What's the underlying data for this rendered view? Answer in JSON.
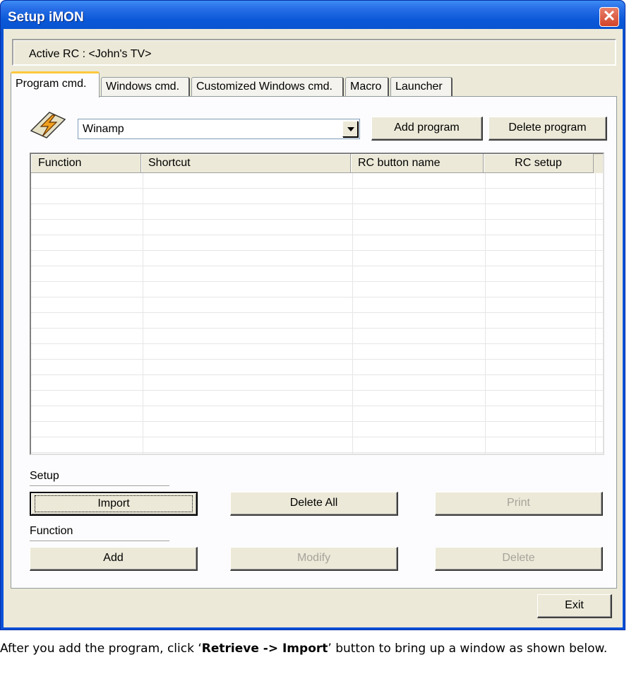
{
  "window": {
    "title": "Setup iMON",
    "close_glyph": "✕"
  },
  "active_rc": {
    "label": "Active RC : <John's TV>"
  },
  "tabs": [
    {
      "label": "Program cmd.",
      "active": true
    },
    {
      "label": "Windows cmd.",
      "active": false
    },
    {
      "label": "Customized Windows cmd.",
      "active": false
    },
    {
      "label": "Macro",
      "active": false
    },
    {
      "label": "Launcher",
      "active": false
    }
  ],
  "program": {
    "icon": "winamp-lightning-icon",
    "selected": "Winamp"
  },
  "buttons": {
    "add_program": "Add program",
    "delete_program": "Delete program",
    "import": "Import",
    "delete_all": "Delete All",
    "print": "Print",
    "add": "Add",
    "modify": "Modify",
    "delete": "Delete",
    "exit": "Exit"
  },
  "table": {
    "columns": [
      "Function",
      "Shortcut",
      "RC button name",
      "RC setup"
    ],
    "rows": []
  },
  "sections": {
    "setup": "Setup",
    "function": "Function"
  },
  "caption": {
    "before": "After you add the program, click ‘",
    "bold": "Retrieve -> Import",
    "after": "’ button to bring up a window as shown below."
  }
}
